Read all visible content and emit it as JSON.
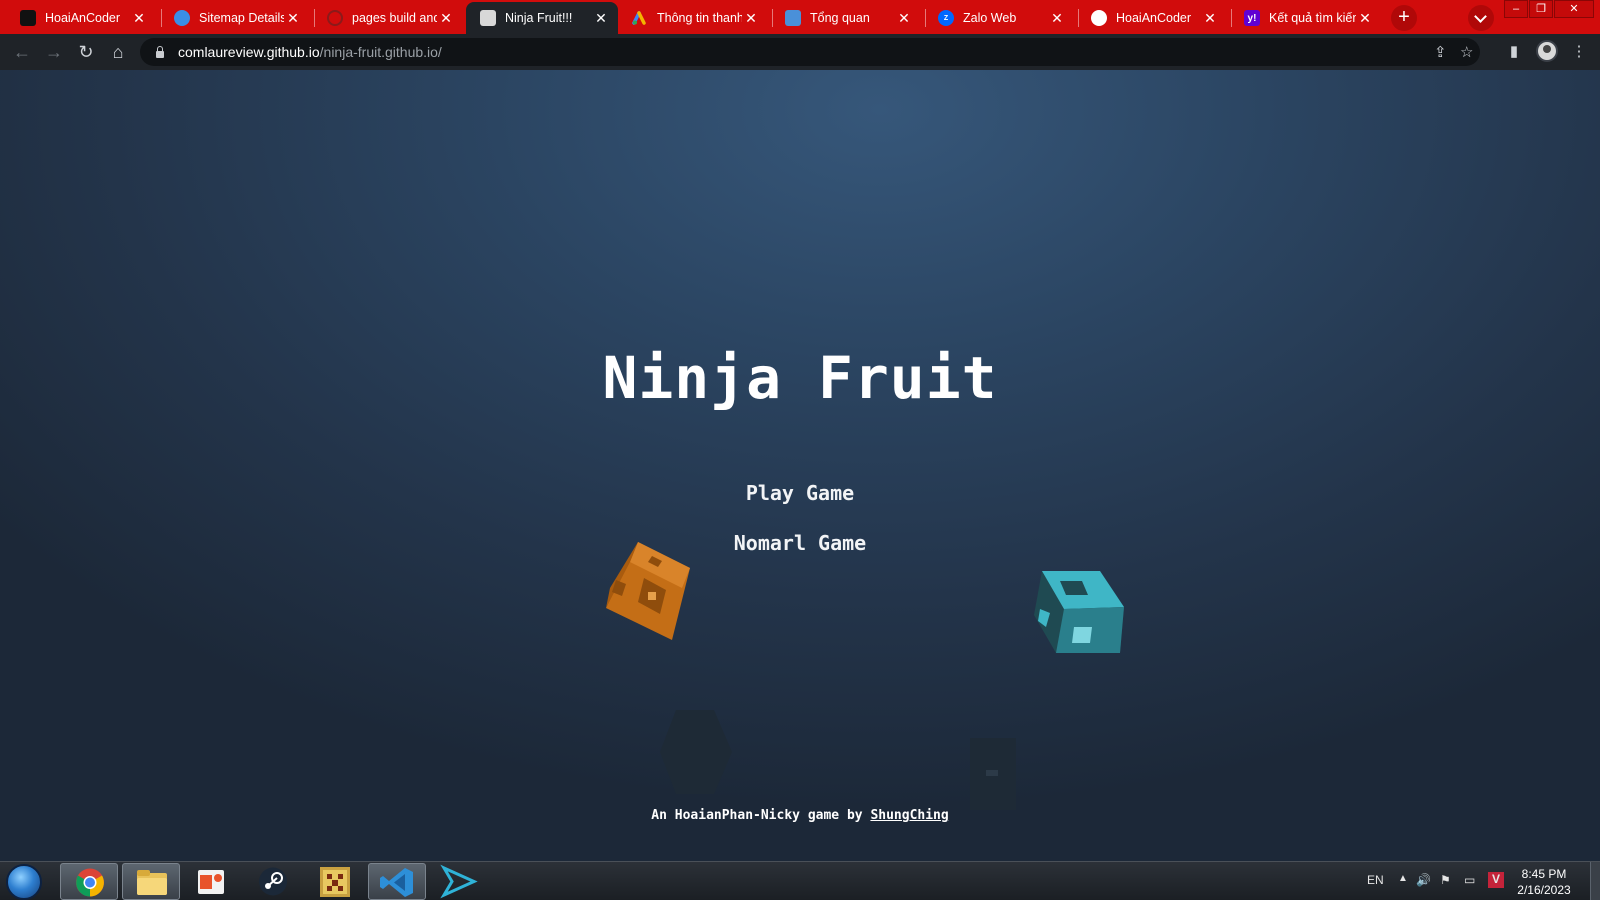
{
  "browser": {
    "tabs": [
      {
        "title": "HoaiAnCoder",
        "icon": "site-black-icon",
        "color": "#111111"
      },
      {
        "title": "Sitemap Details",
        "icon": "globe-icon",
        "color": "#3a8ee6"
      },
      {
        "title": "pages build and",
        "icon": "github-spinner-icon",
        "color": "#8b1a1a"
      },
      {
        "title": "Ninja Fruit!!!",
        "icon": "ninja-avatar-icon",
        "color": "#d8d8d8"
      },
      {
        "title": "Thông tin thanh",
        "icon": "google-ads-icon",
        "color": "#f4b400"
      },
      {
        "title": "Tổng quan",
        "icon": "store-icon",
        "color": "#4a90d9"
      },
      {
        "title": "Zalo Web",
        "icon": "zalo-icon",
        "color": "#0068ff"
      },
      {
        "title": "HoaiAnCoder",
        "icon": "globe-white-icon",
        "color": "#ffffff"
      },
      {
        "title": "Kết quả tìm kiếm",
        "icon": "yahoo-icon",
        "color": "#6001d2"
      }
    ],
    "active_tab_index": 3,
    "new_tab_label": "+",
    "url_host": "comlaureview.github.io",
    "url_path": "/ninja-fruit.github.io/",
    "nav_back": "←",
    "nav_forward": "→",
    "nav_reload": "↻",
    "nav_home": "⌂"
  },
  "game": {
    "title": "Ninja Fruit",
    "play_label": "Play Game",
    "normal_label": "Nomarl Game",
    "credit_prefix": "An HoaianPhan-Nicky game by ",
    "credit_author": "ShungChing"
  },
  "taskbar": {
    "apps": [
      {
        "name": "chrome",
        "icon": "chrome-icon"
      },
      {
        "name": "file-explorer",
        "icon": "folder-icon"
      },
      {
        "name": "office",
        "icon": "office-icon"
      },
      {
        "name": "steam",
        "icon": "steam-icon"
      },
      {
        "name": "dosbox",
        "icon": "dosbox-icon"
      },
      {
        "name": "vscode",
        "icon": "vscode-icon"
      },
      {
        "name": "vscode-insiders",
        "icon": "vscode-insiders-icon"
      }
    ],
    "language": "EN",
    "time": "8:45 PM",
    "date": "2/16/2023"
  },
  "colors": {
    "tabstrip": "#d10c0c",
    "toolbar": "#1f2328",
    "game_bg": "#2b4562",
    "cube_orange": "#c46e16",
    "cube_teal": "#3fb6c6"
  }
}
